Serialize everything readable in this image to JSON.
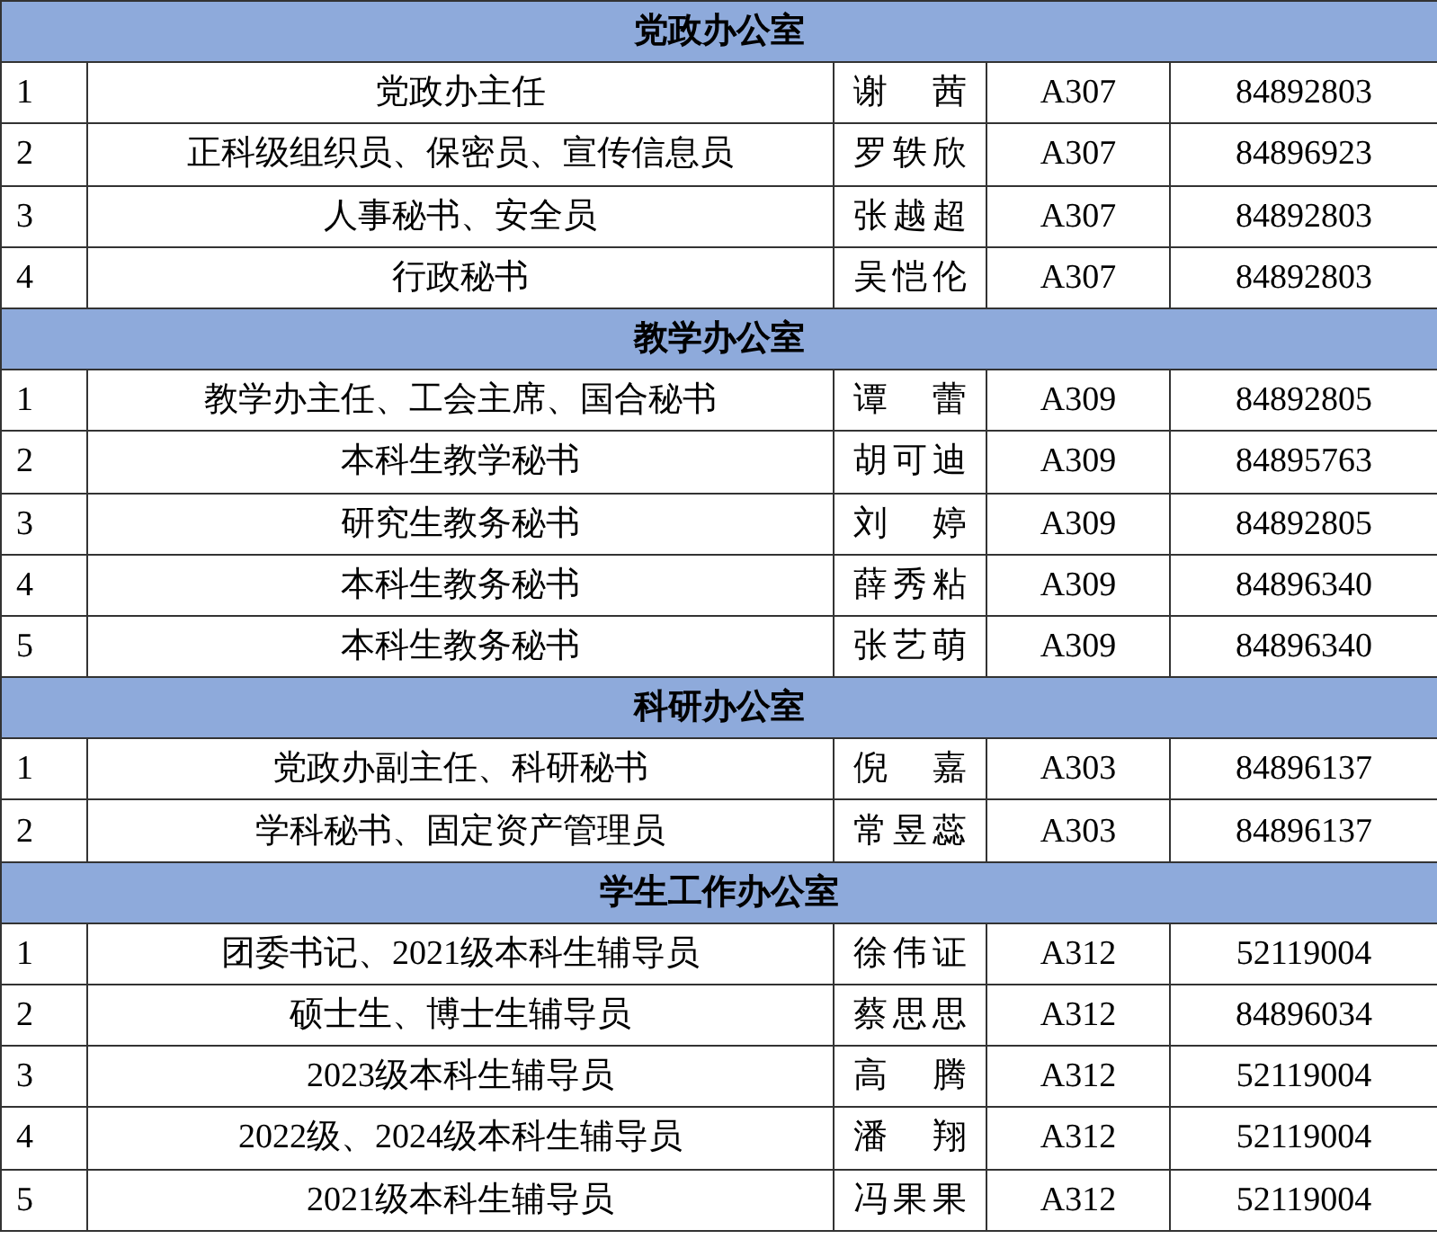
{
  "sections": [
    {
      "title": "党政办公室",
      "rows": [
        [
          "1",
          "党政办主任",
          "谢 茜",
          "A307",
          "84892803"
        ],
        [
          "2",
          "正科级组织员、保密员、宣传信息员",
          "罗轶欣",
          "A307",
          "84896923"
        ],
        [
          "3",
          "人事秘书、安全员",
          "张越超",
          "A307",
          "84892803"
        ],
        [
          "4",
          "行政秘书",
          "吴恺伦",
          "A307",
          "84892803"
        ]
      ]
    },
    {
      "title": "教学办公室",
      "rows": [
        [
          "1",
          "教学办主任、工会主席、国合秘书",
          "谭 蕾",
          "A309",
          "84892805"
        ],
        [
          "2",
          "本科生教学秘书",
          "胡可迪",
          "A309",
          "84895763"
        ],
        [
          "3",
          "研究生教务秘书",
          "刘 婷",
          "A309",
          "84892805"
        ],
        [
          "4",
          "本科生教务秘书",
          "薛秀粘",
          "A309",
          "84896340"
        ],
        [
          "5",
          "本科生教务秘书",
          "张艺萌",
          "A309",
          "84896340"
        ]
      ]
    },
    {
      "title": "科研办公室",
      "rows": [
        [
          "1",
          "党政办副主任、科研秘书",
          "倪 嘉",
          "A303",
          "84896137"
        ],
        [
          "2",
          "学科秘书、固定资产管理员",
          "常昱蕊",
          "A303",
          "84896137"
        ]
      ]
    },
    {
      "title": "学生工作办公室",
      "rows": [
        [
          "1",
          "团委书记、2021级本科生辅导员",
          "徐伟证",
          "A312",
          "52119004"
        ],
        [
          "2",
          "硕士生、博士生辅导员",
          "蔡思思",
          "A312",
          "84896034"
        ],
        [
          "3",
          "2023级本科生辅导员",
          "高 腾",
          "A312",
          "52119004"
        ],
        [
          "4",
          "2022级、2024级本科生辅导员",
          "潘 翔",
          "A312",
          "52119004"
        ],
        [
          "5",
          "2021级本科生辅导员",
          "冯果果",
          "A312",
          "52119004"
        ]
      ]
    }
  ]
}
